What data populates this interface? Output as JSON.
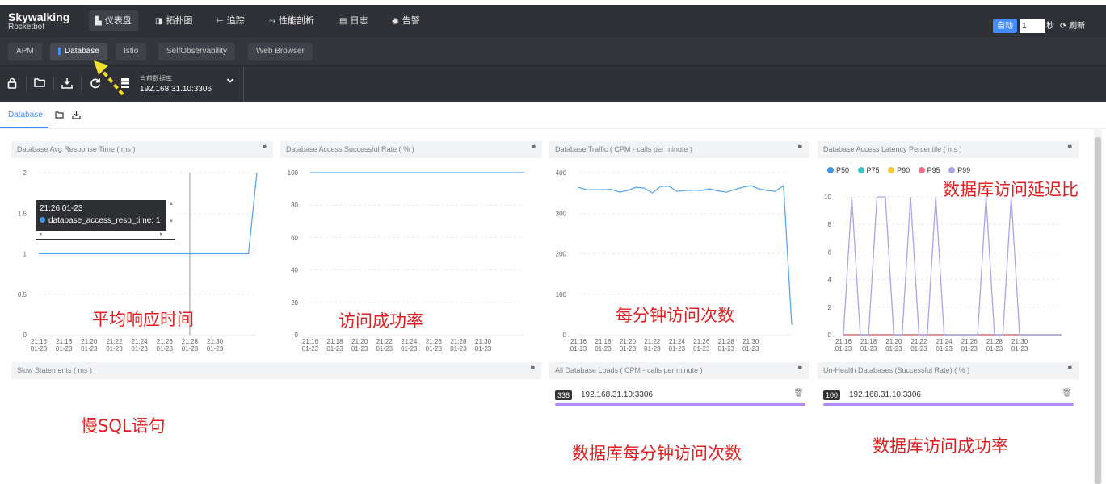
{
  "header": {
    "logo_title": "Skywalking",
    "logo_sub": "Rocketbot",
    "nav": [
      {
        "icon": "dashboard-icon",
        "glyph": "▙",
        "label": "仪表盘",
        "active": true
      },
      {
        "icon": "topology-icon",
        "glyph": "◨",
        "label": "拓扑图"
      },
      {
        "icon": "trace-icon",
        "glyph": "⊢",
        "label": "追踪"
      },
      {
        "icon": "profile-icon",
        "glyph": "⤳",
        "label": "性能剖析"
      },
      {
        "icon": "log-icon",
        "glyph": "▤",
        "label": "日志"
      },
      {
        "icon": "alarm-icon",
        "glyph": "◉",
        "label": "告警"
      }
    ],
    "auto_label": "自动",
    "interval_value": "1",
    "seconds_label": "秒",
    "refresh_label": "刷新"
  },
  "tabs": [
    {
      "label": "APM"
    },
    {
      "label": "Database",
      "active": true
    },
    {
      "label": "Istio"
    },
    {
      "label": "SelfObservability"
    },
    {
      "label": "Web Browser"
    }
  ],
  "toolbar": {
    "db_selector_label": "当前数据库",
    "db_selector_value": "192.168.31.10:3306"
  },
  "subtab": {
    "label": "Database"
  },
  "time_ticks": [
    "21:16",
    "21:18",
    "21:20",
    "21:22",
    "21:24",
    "21:26",
    "21:28",
    "21:30"
  ],
  "time_date": "01-23",
  "panels": {
    "resp_time": {
      "title": "Database Avg Response Time ( ms )"
    },
    "success_rate": {
      "title": "Database Access Successful Rate ( % )"
    },
    "traffic": {
      "title": "Database Traffic ( CPM - calls per minute )"
    },
    "percentile": {
      "title": "Database Access Latency Percentile ( ms )"
    },
    "slow": {
      "title": "Slow Statements ( ms )"
    },
    "loads": {
      "title": "All Database Loads ( CPM - calls per minute )",
      "badge": "338",
      "addr": "192.168.31.10:3306",
      "bar_fill": 1.0
    },
    "unhealth": {
      "title": "Un-Health Databases (Successful Rate) ( % )",
      "badge": "100",
      "addr": "192.168.31.10:3306",
      "bar_fill": 1.0
    }
  },
  "tooltip": {
    "time": "21:26 01-23",
    "series": "database_access_resp_time: 1"
  },
  "colors": {
    "accent": "#448dfe",
    "series_blue": "#5aa6ea",
    "p50": "#3f96e3",
    "p75": "#40c4c4",
    "p90": "#f7c93b",
    "p95": "#f07088",
    "p99": "#a9a6e8",
    "annotation": "#e02020",
    "bar": "#b38bf7"
  },
  "annotations": {
    "resp": "平均响应时间",
    "rate": "访问成功率",
    "traffic": "每分钟访问次数",
    "latency": "数据库访问延迟比",
    "slow": "慢SQL语句",
    "loads": "数据库每分钟访问次数",
    "unhealth": "数据库访问成功率"
  },
  "chart_data": [
    {
      "type": "line",
      "title": "Database Avg Response Time ( ms )",
      "x_count": 27,
      "ylim": [
        0,
        2
      ],
      "yticks": [
        "0",
        "0.5",
        "1",
        "1.5",
        "2"
      ],
      "series": [
        {
          "values": [
            1,
            1,
            1,
            1,
            1,
            1,
            1,
            1,
            1,
            1,
            1,
            1,
            1,
            1,
            1,
            1,
            1,
            1,
            1,
            1,
            1,
            1,
            1,
            1,
            1,
            1,
            2
          ]
        }
      ],
      "cursor_index": 18
    },
    {
      "type": "line",
      "title": "Database Access Successful Rate ( % )",
      "x_count": 27,
      "ylim": [
        0,
        100
      ],
      "yticks": [
        "0",
        "20",
        "40",
        "60",
        "80",
        "100"
      ],
      "series": [
        {
          "values": [
            100,
            100,
            100,
            100,
            100,
            100,
            100,
            100,
            100,
            100,
            100,
            100,
            100,
            100,
            100,
            100,
            100,
            100,
            100,
            100,
            100,
            100,
            100,
            100,
            100,
            100,
            100
          ]
        }
      ]
    },
    {
      "type": "line",
      "title": "Database Traffic ( CPM - calls per minute )",
      "x_count": 27,
      "ylim": [
        0,
        400
      ],
      "yticks": [
        "0",
        "100",
        "200",
        "300",
        "400"
      ],
      "series": [
        {
          "values": [
            364,
            358,
            358,
            358,
            359,
            352,
            356,
            364,
            362,
            350,
            366,
            367,
            354,
            356,
            357,
            356,
            360,
            355,
            352,
            358,
            364,
            368,
            360,
            356,
            354,
            368,
            25
          ]
        }
      ]
    },
    {
      "type": "line",
      "title": "Database Access Latency Percentile ( ms )",
      "x_count": 27,
      "ylim": [
        0,
        10
      ],
      "yticks": [
        "0",
        "2",
        "4",
        "6",
        "8",
        "10"
      ],
      "series": [
        {
          "name": "P50",
          "values": [
            0,
            0,
            0,
            0,
            0,
            0,
            0,
            0,
            0,
            0,
            0,
            0,
            0,
            0,
            0,
            0,
            0,
            0,
            0,
            0,
            0,
            0,
            0,
            0,
            0,
            0,
            0
          ]
        },
        {
          "name": "P75",
          "values": [
            0,
            0,
            0,
            0,
            0,
            0,
            0,
            0,
            0,
            0,
            0,
            0,
            0,
            0,
            0,
            0,
            0,
            0,
            0,
            0,
            0,
            0,
            0,
            0,
            0,
            0,
            0
          ]
        },
        {
          "name": "P90",
          "values": [
            0,
            0,
            0,
            0,
            0,
            0,
            0,
            0,
            0,
            0,
            0,
            0,
            0,
            0,
            0,
            0,
            0,
            0,
            0,
            0,
            0,
            0,
            0,
            0,
            0,
            0,
            0
          ]
        },
        {
          "name": "P95",
          "values": [
            0,
            0,
            0,
            0,
            0,
            0,
            0,
            0,
            0,
            0,
            0,
            0,
            0,
            0,
            0,
            0,
            0,
            0,
            0,
            0,
            0,
            0,
            0,
            0,
            0,
            0,
            0
          ]
        },
        {
          "name": "P99",
          "values": [
            0,
            10,
            0,
            0,
            10,
            10,
            0,
            0,
            10,
            0,
            0,
            10,
            0,
            0,
            0,
            0,
            0,
            10,
            0,
            0,
            10,
            0,
            0,
            0,
            0,
            0,
            0
          ]
        }
      ]
    }
  ]
}
